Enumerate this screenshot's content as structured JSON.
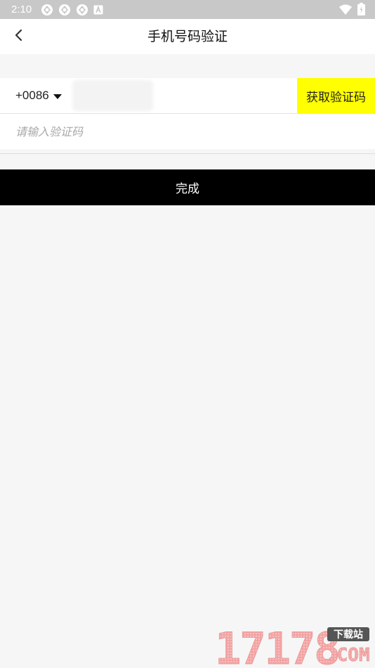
{
  "status_bar": {
    "time": "2:10",
    "left_icons": [
      "app-notification-icon",
      "app-notification-icon",
      "app-notification-icon",
      "text-notification-icon"
    ],
    "right_icons": [
      "wifi-icon",
      "battery-icon"
    ]
  },
  "header": {
    "title": "手机号码验证",
    "back_icon": "chevron-left-icon"
  },
  "phone": {
    "country_code": "+0086",
    "dropdown_icon": "caret-down-icon",
    "get_code_label": "获取验证码"
  },
  "code": {
    "placeholder": "请输入验证码"
  },
  "done_label": "完成",
  "watermark": {
    "text": "17178",
    "suffix": ".COM",
    "badge": "下载站"
  },
  "colors": {
    "accent_yellow": "#ffff00",
    "done_button": "#000000",
    "background": "#f6f6f6",
    "status_bar": "#c8c8c8"
  }
}
